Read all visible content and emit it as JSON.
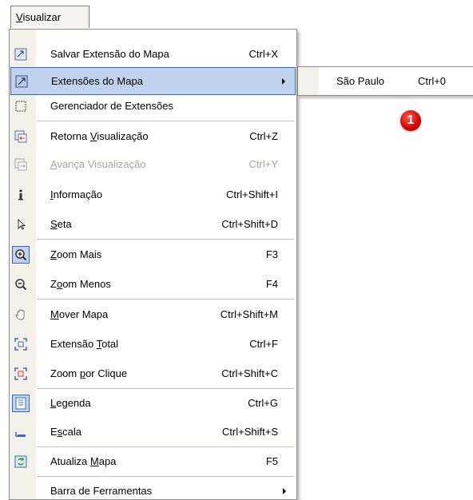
{
  "menubar": {
    "title_first": "V",
    "title_rest": "isualizar"
  },
  "menu": {
    "items": [
      {
        "label": "Salvar Extensão do Mapa",
        "shortcut": "Ctrl+X",
        "icon": "save-extent-icon"
      },
      {
        "label": "Extensões do Mapa",
        "shortcut": "",
        "icon": "map-extents-icon",
        "submenu": true,
        "highlighted": true
      },
      {
        "label": "Gerenciador de Extensões",
        "shortcut": "",
        "icon": "extent-manager-icon"
      },
      {
        "label_pre": "Retorna ",
        "label_u": "V",
        "label_post": "isualização",
        "shortcut": "Ctrl+Z",
        "icon": "back-view-icon"
      },
      {
        "label_u": "A",
        "label_post": "vança Visualização",
        "shortcut": "Ctrl+Y",
        "icon": "forward-view-icon",
        "disabled": true
      },
      {
        "label_u": "I",
        "label_post": "nformação",
        "shortcut": "Ctrl+Shift+I",
        "icon": "info-icon"
      },
      {
        "label_u": "S",
        "label_post": "eta",
        "shortcut": "Ctrl+Shift+D",
        "icon": "arrow-pointer-icon"
      },
      {
        "label_u": "Z",
        "label_post": "oom Mais",
        "shortcut": "F3",
        "icon": "zoom-in-icon"
      },
      {
        "label_pre": "Z",
        "label_u": "o",
        "label_post": "om Menos",
        "shortcut": "F4",
        "icon": "zoom-out-icon"
      },
      {
        "label_u": "M",
        "label_post": "over Mapa",
        "shortcut": "Ctrl+Shift+M",
        "icon": "hand-pan-icon"
      },
      {
        "label_pre": "Extensão ",
        "label_u": "T",
        "label_post": "otal",
        "shortcut": "Ctrl+F",
        "icon": "full-extent-icon"
      },
      {
        "label_pre": "Zoom ",
        "label_u": "p",
        "label_post": "or Clique",
        "shortcut": "Ctrl+Shift+C",
        "icon": "zoom-click-icon"
      },
      {
        "label_u": "L",
        "label_post": "egenda",
        "shortcut": "Ctrl+G",
        "icon": "legend-icon"
      },
      {
        "label_pre": "E",
        "label_u": "s",
        "label_post": "cala",
        "shortcut": "Ctrl+Shift+S",
        "icon": "scale-icon"
      },
      {
        "label_pre": "Atualiza ",
        "label_u": "M",
        "label_post": "apa",
        "shortcut": "F5",
        "icon": "refresh-map-icon"
      },
      {
        "label": "Barra de Ferramentas",
        "shortcut": "",
        "icon": "",
        "submenu": true
      }
    ]
  },
  "submenu": {
    "label": "São Paulo",
    "shortcut": "Ctrl+0"
  },
  "badge": {
    "text": "1"
  }
}
